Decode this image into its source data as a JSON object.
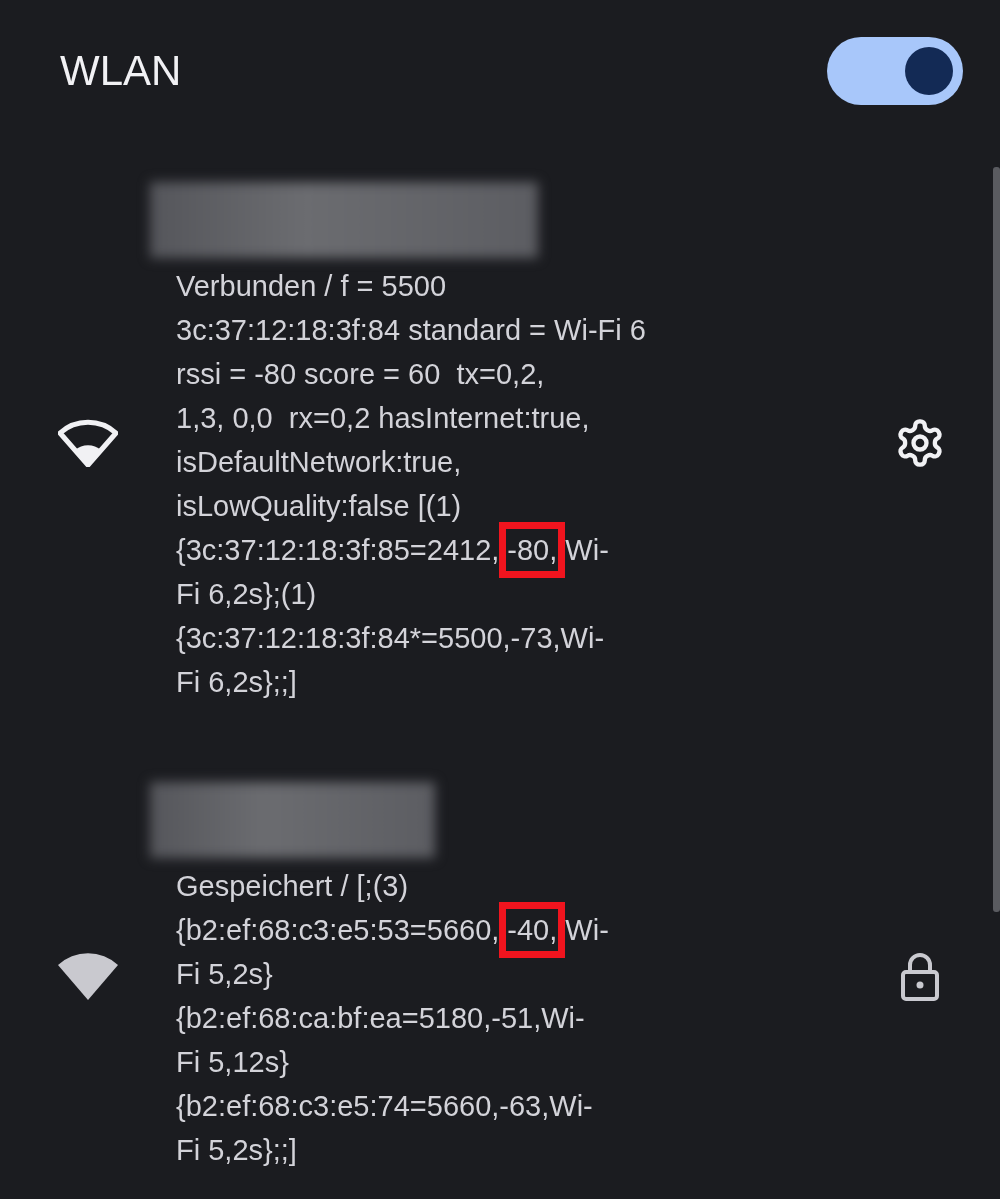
{
  "header": {
    "title": "WLAN",
    "toggle": {
      "on": true
    }
  },
  "networks": [
    {
      "kind": "connected",
      "lines": [
        {
          "parts": [
            {
              "text": "Verbunden / f = 5500"
            }
          ]
        },
        {
          "parts": [
            {
              "text": "3c:37:12:18:3f:84 standard = Wi-Fi 6"
            }
          ]
        },
        {
          "parts": [
            {
              "text": "rssi = -80 score = 60  tx=0,2,"
            }
          ]
        },
        {
          "parts": [
            {
              "text": "1,3, 0,0  rx=0,2 hasInternet:true,"
            }
          ]
        },
        {
          "parts": [
            {
              "text": "isDefaultNetwork:true,"
            }
          ]
        },
        {
          "parts": [
            {
              "text": "isLowQuality:false [(1)"
            }
          ]
        },
        {
          "parts": [
            {
              "text": "{3c:37:12:18:3f:85=2412,",
              "highlighted": false
            },
            {
              "text": "-80,",
              "highlighted": true
            },
            {
              "text": "Wi-",
              "highlighted": false
            }
          ]
        },
        {
          "parts": [
            {
              "text": "Fi 6,2s};(1)"
            }
          ]
        },
        {
          "parts": [
            {
              "text": "{3c:37:12:18:3f:84*=5500,-73,Wi-"
            }
          ]
        },
        {
          "parts": [
            {
              "text": "Fi 6,2s};;]"
            }
          ]
        }
      ]
    },
    {
      "kind": "saved",
      "lines": [
        {
          "parts": [
            {
              "text": "Gespeichert / [;(3)"
            }
          ]
        },
        {
          "parts": [
            {
              "text": "{b2:ef:68:c3:e5:53=5660,",
              "highlighted": false
            },
            {
              "text": "-40,",
              "highlighted": true
            },
            {
              "text": "Wi-",
              "highlighted": false
            }
          ]
        },
        {
          "parts": [
            {
              "text": "Fi 5,2s}"
            }
          ]
        },
        {
          "parts": [
            {
              "text": "{b2:ef:68:ca:bf:ea=5180,-51,Wi-"
            }
          ]
        },
        {
          "parts": [
            {
              "text": "Fi 5,12s}"
            }
          ]
        },
        {
          "parts": [
            {
              "text": "{b2:ef:68:c3:e5:74=5660,-63,Wi-"
            }
          ]
        },
        {
          "parts": [
            {
              "text": "Fi 5,2s};;]"
            }
          ]
        }
      ]
    }
  ]
}
